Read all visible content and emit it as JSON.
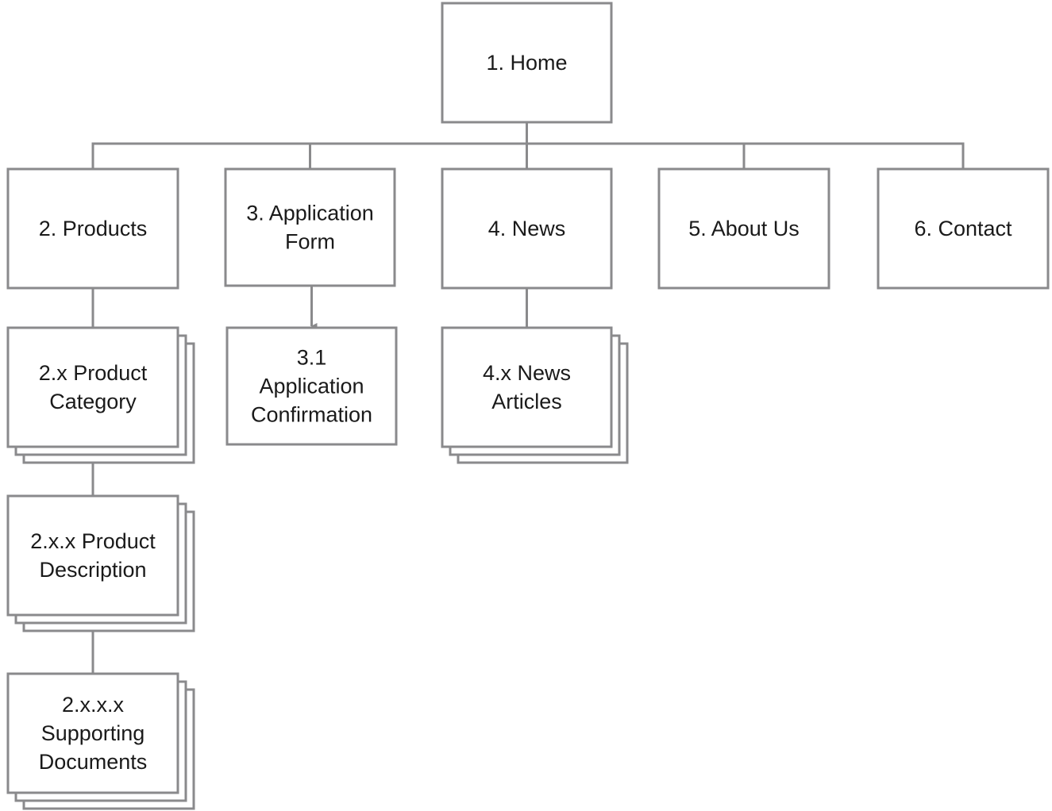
{
  "diagram": {
    "type": "sitemap",
    "stroke_color": "#8a8a8c",
    "nodes": [
      {
        "id": "home",
        "lines": [
          "1. Home"
        ],
        "stacked": false
      },
      {
        "id": "products",
        "lines": [
          "2. Products"
        ],
        "stacked": false
      },
      {
        "id": "application-form",
        "lines": [
          "3. Application",
          "Form"
        ],
        "stacked": false
      },
      {
        "id": "news",
        "lines": [
          "4. News"
        ],
        "stacked": false
      },
      {
        "id": "about-us",
        "lines": [
          "5. About Us"
        ],
        "stacked": false
      },
      {
        "id": "contact",
        "lines": [
          "6. Contact"
        ],
        "stacked": false
      },
      {
        "id": "product-category",
        "lines": [
          "2.x Product",
          "Category"
        ],
        "stacked": true
      },
      {
        "id": "application-confirmation",
        "lines": [
          "3.1",
          "Application",
          "Confirmation"
        ],
        "stacked": false
      },
      {
        "id": "news-articles",
        "lines": [
          "4.x News",
          "Articles"
        ],
        "stacked": true
      },
      {
        "id": "product-description",
        "lines": [
          "2.x.x Product",
          "Description"
        ],
        "stacked": true
      },
      {
        "id": "supporting-documents",
        "lines": [
          "2.x.x.x",
          "Supporting",
          "Documents"
        ],
        "stacked": true
      }
    ],
    "edges": [
      {
        "from": "home",
        "to": "products"
      },
      {
        "from": "home",
        "to": "application-form"
      },
      {
        "from": "home",
        "to": "news"
      },
      {
        "from": "home",
        "to": "about-us"
      },
      {
        "from": "home",
        "to": "contact"
      },
      {
        "from": "products",
        "to": "product-category"
      },
      {
        "from": "application-form",
        "to": "application-confirmation",
        "arrow": true
      },
      {
        "from": "news",
        "to": "news-articles"
      },
      {
        "from": "product-category",
        "to": "product-description"
      },
      {
        "from": "product-description",
        "to": "supporting-documents"
      }
    ]
  }
}
